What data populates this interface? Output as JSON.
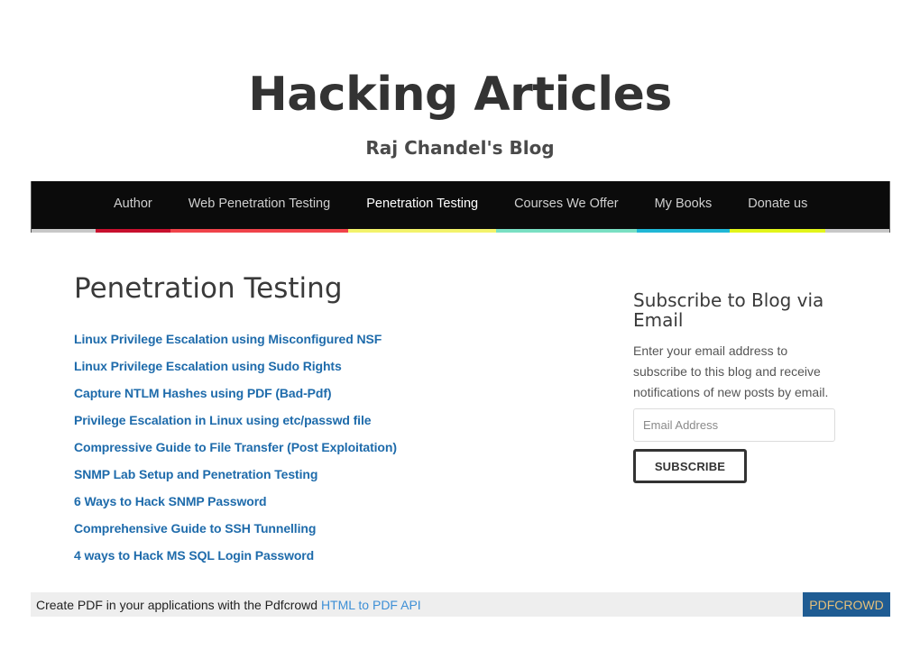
{
  "header": {
    "site_title": "Hacking Articles",
    "tagline": "Raj Chandel's Blog"
  },
  "nav": {
    "items": [
      {
        "label": "Author",
        "stripe_color": "#c8102e",
        "active": false
      },
      {
        "label": "Web Penetration Testing",
        "stripe_color": "#f0434a",
        "active": false
      },
      {
        "label": "Penetration Testing",
        "stripe_color": "#f3f36b",
        "active": true
      },
      {
        "label": "Courses We Offer",
        "stripe_color": "#7ae0c3",
        "active": false
      },
      {
        "label": "My Books",
        "stripe_color": "#1fb7d6",
        "active": false
      },
      {
        "label": "Donate us",
        "stripe_color": "#e2f51a",
        "active": false
      }
    ],
    "base_stripe_color": "#c8c8c8",
    "background_color": "#0b0b0b"
  },
  "main": {
    "title": "Penetration Testing",
    "posts": [
      "Linux Privilege Escalation using Misconfigured NSF",
      "Linux Privilege Escalation using Sudo Rights",
      "Capture NTLM Hashes using PDF (Bad-Pdf)",
      "Privilege Escalation in Linux using etc/passwd file",
      "Compressive Guide to File Transfer (Post Exploitation)",
      "SNMP Lab Setup and Penetration Testing",
      "6 Ways to Hack SNMP Password",
      "Comprehensive Guide to SSH Tunnelling",
      "4 ways to Hack MS SQL Login Password"
    ],
    "link_color": "#1e6bab"
  },
  "sidebar": {
    "subscribe": {
      "title": "Subscribe to Blog via Email",
      "description": "Enter your email address to subscribe to this blog and receive notifications of new posts by email.",
      "email_placeholder": "Email Address",
      "email_value": "",
      "button_label": "SUBSCRIBE"
    }
  },
  "footer": {
    "pdf_text": "Create PDF in your applications with the Pdfcrowd",
    "pdf_link": "HTML to PDF API",
    "pdf_brand": "PDFCROWD"
  }
}
